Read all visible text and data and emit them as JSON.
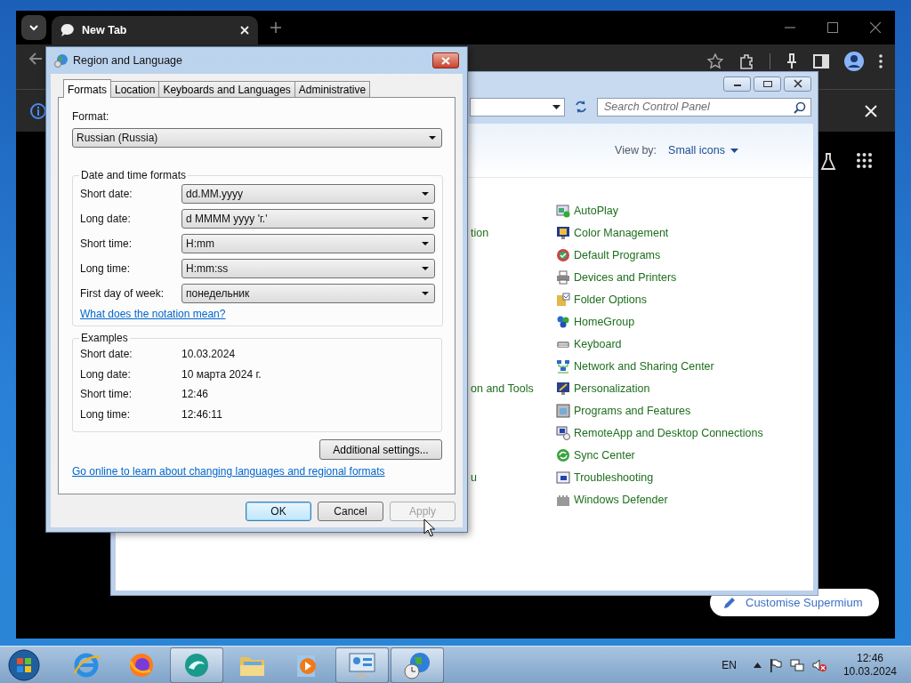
{
  "browser": {
    "tab_title": "New Tab",
    "customise_button": "Customise Supermium"
  },
  "control_panel": {
    "search": {
      "placeholder": "Search Control Panel"
    },
    "view_by_label": "View by:",
    "view_by_value": "Small icons",
    "items": [
      {
        "kind": "autoplay",
        "label": "AutoPlay"
      },
      {
        "kind": "color",
        "label": "Color Management",
        "left_text": "tion"
      },
      {
        "kind": "defaults",
        "label": "Default Programs"
      },
      {
        "kind": "printer",
        "label": "Devices and Printers"
      },
      {
        "kind": "folder",
        "label": "Folder Options"
      },
      {
        "kind": "homegroup",
        "label": "HomeGroup"
      },
      {
        "kind": "keyboard",
        "label": "Keyboard"
      },
      {
        "kind": "network",
        "label": "Network and Sharing Center"
      },
      {
        "kind": "personalize",
        "label": "Personalization",
        "left_text": "on and Tools"
      },
      {
        "kind": "programs",
        "label": "Programs and Features"
      },
      {
        "kind": "remote",
        "label": "RemoteApp and Desktop Connections"
      },
      {
        "kind": "sync",
        "label": "Sync Center"
      },
      {
        "kind": "troubleshoot",
        "label": "Troubleshooting",
        "left_text": "u"
      },
      {
        "kind": "defender",
        "label": "Windows Defender"
      }
    ]
  },
  "dialog": {
    "title": "Region and Language",
    "tabs": [
      {
        "label": "Formats",
        "selected": true
      },
      {
        "label": "Location",
        "selected": false
      },
      {
        "label": "Keyboards and Languages",
        "selected": false
      },
      {
        "label": "Administrative",
        "selected": false
      }
    ],
    "format_label": "Format:",
    "format_value": "Russian (Russia)",
    "group_title": "Date and time formats",
    "fields": [
      {
        "label": "Short date:",
        "value": "dd.MM.yyyy"
      },
      {
        "label": "Long date:",
        "value": "d MMMM yyyy 'г.'"
      },
      {
        "label": "Short time:",
        "value": "H:mm"
      },
      {
        "label": "Long time:",
        "value": "H:mm:ss"
      },
      {
        "label": "First day of week:",
        "value": "понедельник"
      }
    ],
    "notation_link": "What does the notation mean?",
    "examples_title": "Examples",
    "examples": [
      {
        "label": "Short date:",
        "value": "10.03.2024"
      },
      {
        "label": "Long date:",
        "value": "10 марта 2024 г."
      },
      {
        "label": "Short time:",
        "value": "12:46"
      },
      {
        "label": "Long time:",
        "value": "12:46:11"
      }
    ],
    "additional_button": "Additional settings...",
    "online_link": "Go online to learn about changing languages and regional formats",
    "buttons": [
      {
        "label": "OK",
        "default": true,
        "disabled": false
      },
      {
        "label": "Cancel",
        "default": false,
        "disabled": false
      },
      {
        "label": "Apply",
        "default": false,
        "disabled": true
      }
    ]
  },
  "taskbar": {
    "apps": [
      {
        "kind": "ie",
        "open": false
      },
      {
        "kind": "firefox",
        "open": false
      },
      {
        "kind": "supermium",
        "open": true
      },
      {
        "kind": "explorer",
        "open": false
      },
      {
        "kind": "media",
        "open": false
      },
      {
        "kind": "controlpanel",
        "open": true
      },
      {
        "kind": "region",
        "open": true
      }
    ],
    "language": "EN",
    "time": "12:46",
    "date": "10.03.2024"
  }
}
